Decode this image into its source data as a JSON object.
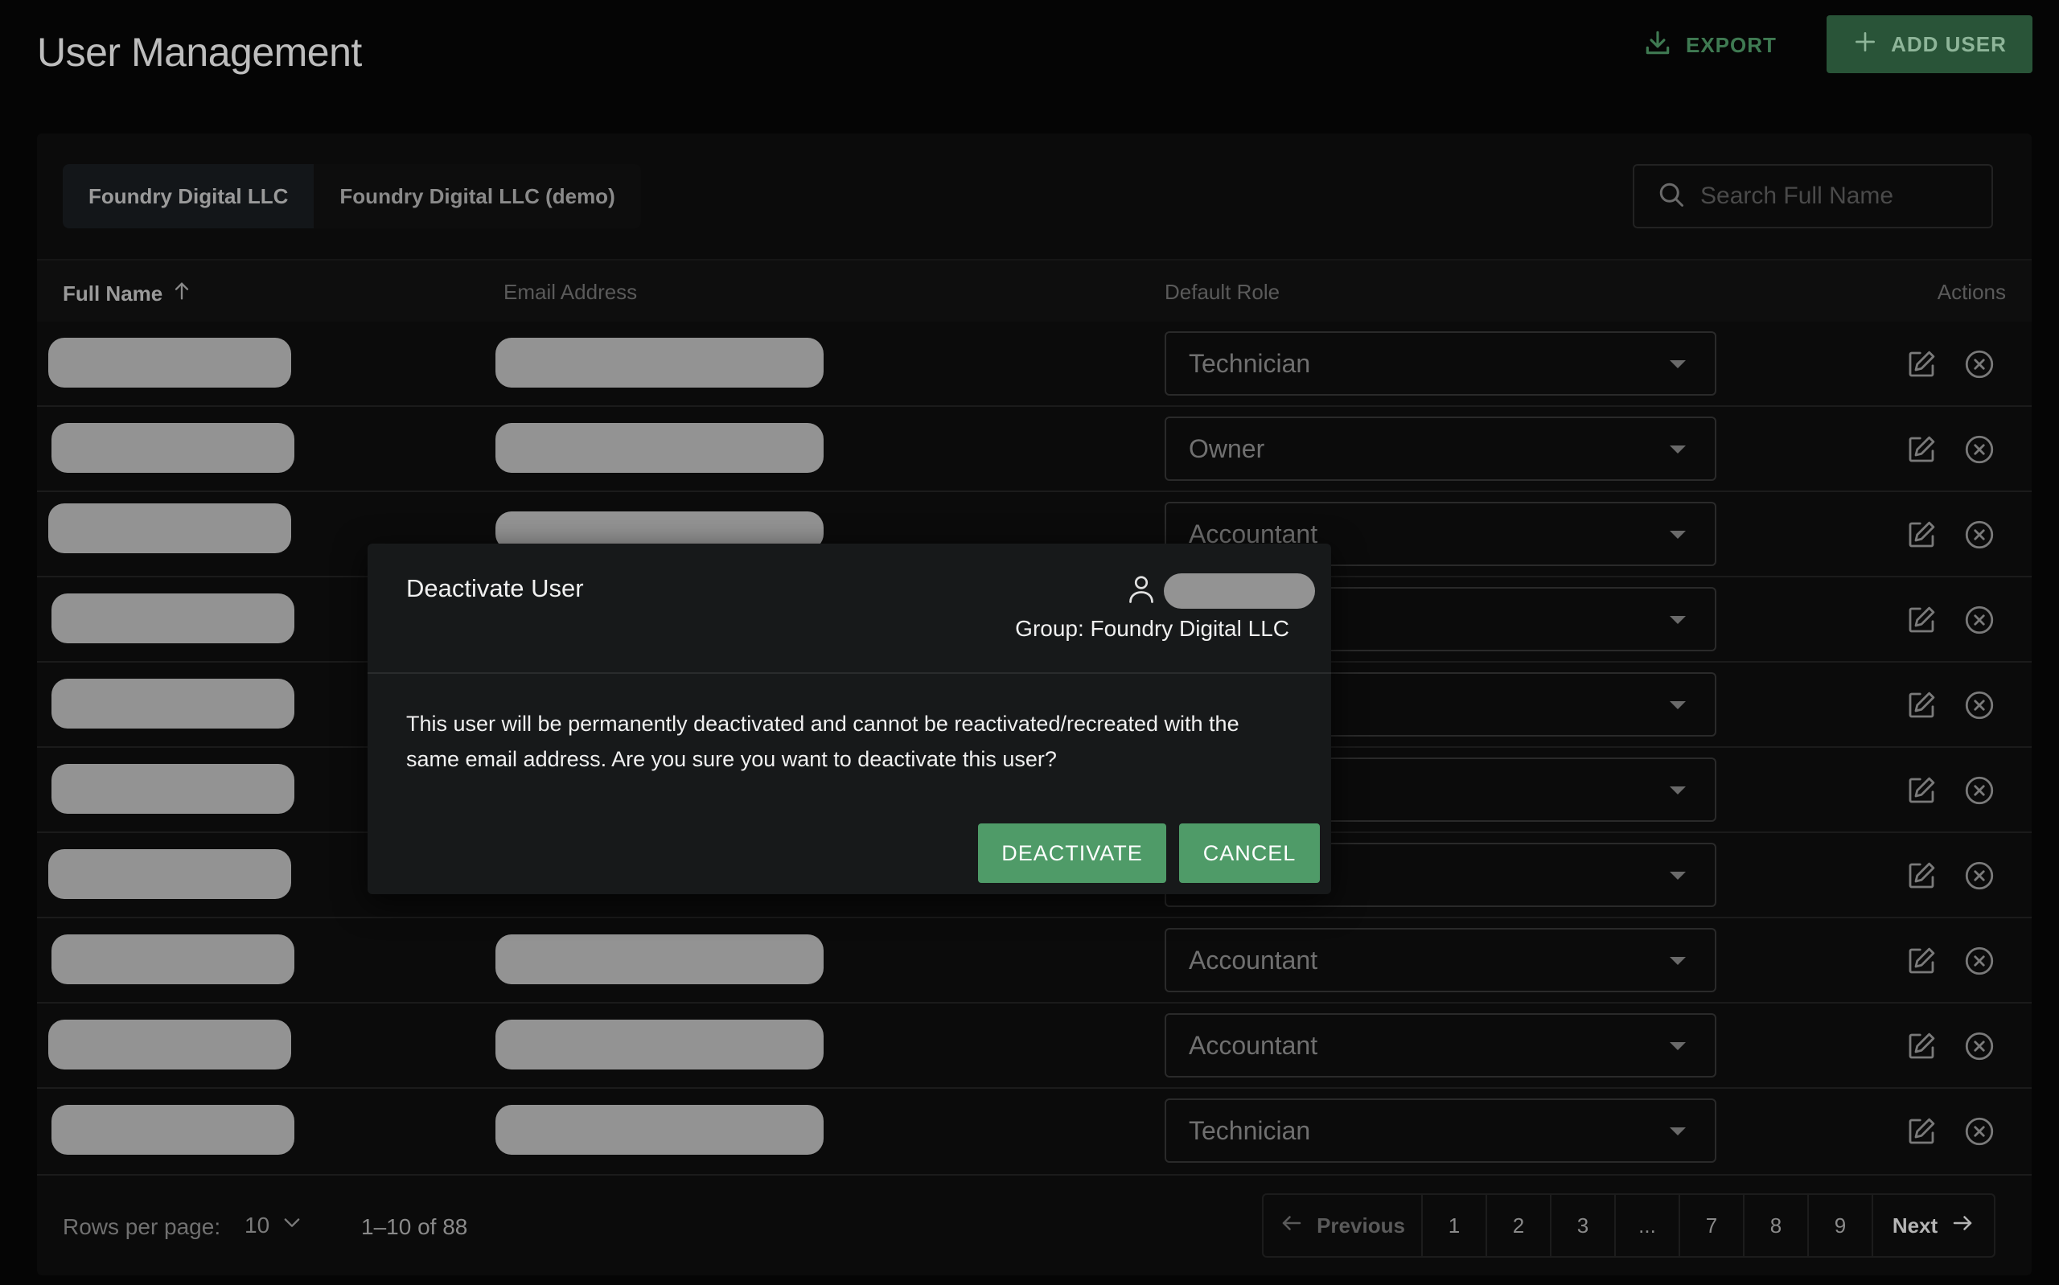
{
  "header": {
    "title": "User Management",
    "export_label": "EXPORT",
    "add_user_label": "ADD USER",
    "accent_color": "#4f9b68"
  },
  "tabs": [
    {
      "label": "Foundry Digital LLC",
      "active": true
    },
    {
      "label": "Foundry Digital LLC (demo)",
      "active": false
    }
  ],
  "search": {
    "placeholder": "Search Full Name",
    "value": ""
  },
  "table": {
    "columns": {
      "name": "Full Name",
      "email": "Email Address",
      "role": "Default Role",
      "actions": "Actions"
    },
    "sort": {
      "column": "name",
      "direction": "asc"
    },
    "rows": [
      {
        "role": "Technician"
      },
      {
        "role": "Owner"
      },
      {
        "role": "Accountant"
      },
      {
        "role": ""
      },
      {
        "role": ""
      },
      {
        "role": ""
      },
      {
        "role": ""
      },
      {
        "role": "Accountant"
      },
      {
        "role": "Accountant"
      },
      {
        "role": "Technician"
      }
    ]
  },
  "footer": {
    "rows_per_page_label": "Rows per page:",
    "rows_per_page_value": "10",
    "range": "1–10 of 88",
    "pagination": {
      "previous": "Previous",
      "next": "Next",
      "pages": [
        "1",
        "2",
        "3",
        "...",
        "7",
        "8",
        "9"
      ]
    }
  },
  "modal": {
    "title": "Deactivate User",
    "group": "Group: Foundry Digital LLC",
    "body": "This user will be permanently deactivated and cannot be reactivated/recreated with the same email address. Are you sure you want to deactivate this user?",
    "deactivate_label": "DEACTIVATE",
    "cancel_label": "CANCEL"
  }
}
